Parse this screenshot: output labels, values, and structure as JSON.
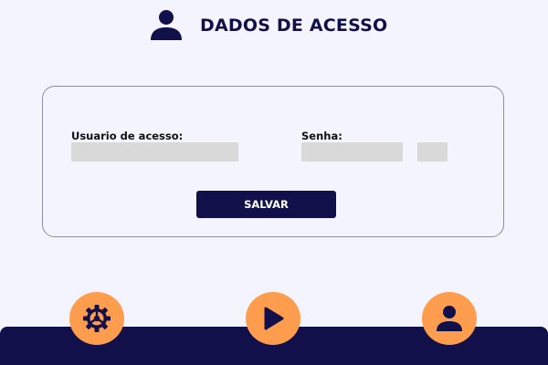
{
  "header": {
    "title": "DADOS DE ACESSO",
    "icon": "user-icon"
  },
  "form": {
    "username_label": "Usuario de acesso:",
    "username_value": "",
    "password_label": "Senha:",
    "password_value": "",
    "password_extra_value": "",
    "save_label": "SALVAR"
  },
  "nav": [
    {
      "icon": "settings-icon"
    },
    {
      "icon": "play-icon"
    },
    {
      "icon": "profile-icon"
    }
  ],
  "colors": {
    "primary": "#12104a",
    "accent": "#ff9d4f",
    "background": "#f3f4fd",
    "field": "#d9d9d9"
  }
}
